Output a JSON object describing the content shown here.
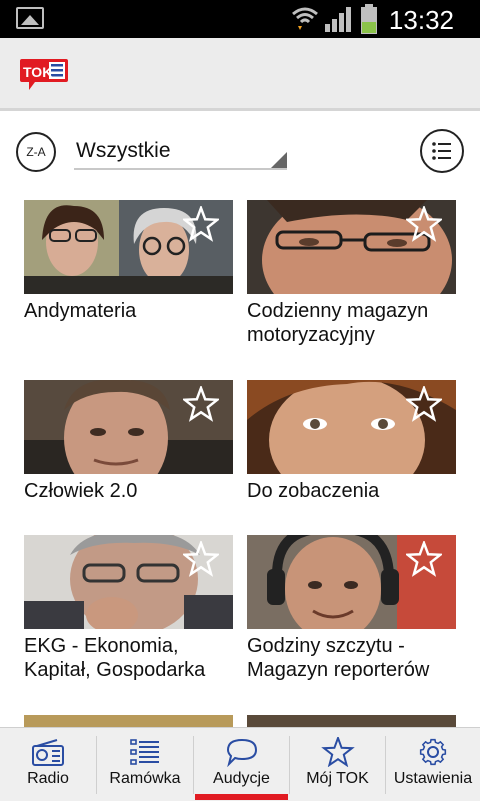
{
  "status": {
    "time": "13:32"
  },
  "app": {
    "logo_text": "TOK"
  },
  "filter": {
    "sort_label": "Z-A",
    "category": "Wszystkie"
  },
  "programs": [
    {
      "title": "Andymateria"
    },
    {
      "title": "Codzienny magazyn motoryzacyjny"
    },
    {
      "title": "Człowiek 2.0"
    },
    {
      "title": "Do zobaczenia"
    },
    {
      "title": "EKG - Ekonomia, Kapitał, Gospodarka"
    },
    {
      "title": "Godziny szczytu - Magazyn reporterów"
    }
  ],
  "nav": {
    "items": [
      {
        "label": "Radio",
        "icon": "radio-icon"
      },
      {
        "label": "Ramówka",
        "icon": "schedule-list-icon"
      },
      {
        "label": "Audycje",
        "icon": "speech-bubble-icon"
      },
      {
        "label": "Mój TOK",
        "icon": "star-icon"
      },
      {
        "label": "Ustawienia",
        "icon": "gear-icon"
      }
    ],
    "active": "Audycje"
  },
  "colors": {
    "accent": "#e11b22",
    "logo_blue": "#2a4da3"
  }
}
